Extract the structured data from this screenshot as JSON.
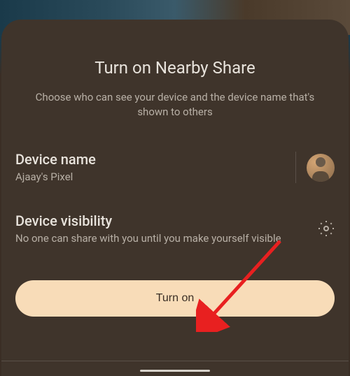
{
  "sheet": {
    "title": "Turn on Nearby Share",
    "subtitle": "Choose who can see your device and the device name that's shown to others"
  },
  "deviceName": {
    "label": "Device name",
    "value": "Ajaay's Pixel"
  },
  "deviceVisibility": {
    "label": "Device visibility",
    "description": "No one can share with you until you make yourself visible"
  },
  "button": {
    "turnOn": "Turn on"
  },
  "colors": {
    "sheetBg": "#3f342b",
    "accent": "#f8dcb8",
    "textPrimary": "#e8e3dc",
    "textSecondary": "#b8b0a6"
  }
}
